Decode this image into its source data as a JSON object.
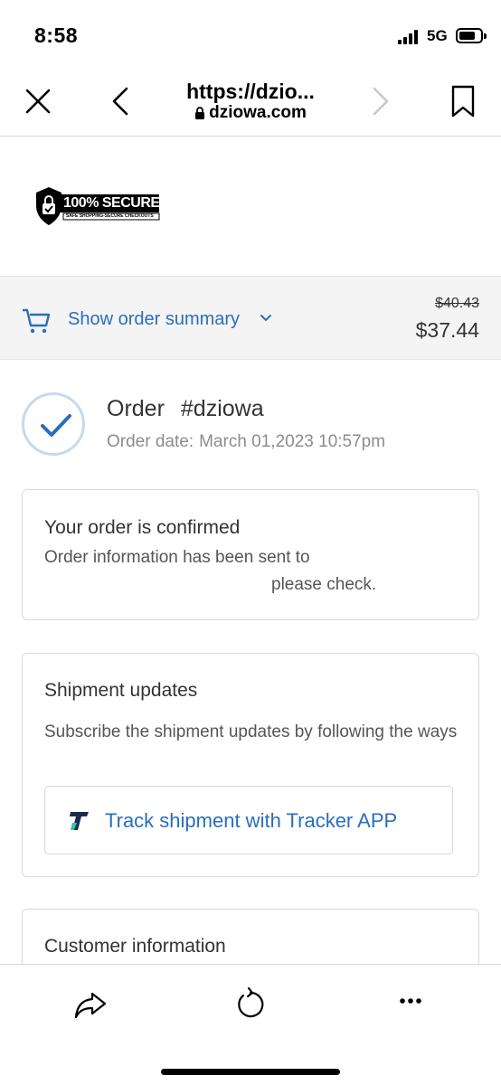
{
  "status_bar": {
    "time": "8:58",
    "network": "5G"
  },
  "browser": {
    "url_title": "https://dzio...",
    "domain": "dziowa.com",
    "icons": [
      "close-icon",
      "back-icon",
      "forward-icon",
      "bookmark-icon",
      "lock-icon"
    ]
  },
  "badge": {
    "title": "100% SECURE",
    "subtitle": "SAFE SHOPPING-SECURE CHECKOUTS"
  },
  "order_summary": {
    "label": "Show order summary",
    "original_price": "$40.43",
    "price": "$37.44",
    "accent_color": "#2a6ebb"
  },
  "order": {
    "label": "Order",
    "number": "#dziowa",
    "date_label": "Order date:",
    "date_value": "March 01,2023 10:57pm"
  },
  "confirm_card": {
    "title": "Your order is confirmed",
    "line1": "Order information has been sent to",
    "line2": "please check."
  },
  "shipment_card": {
    "title": "Shipment updates",
    "description": "Subscribe the shipment updates by following the ways",
    "track_button": "Track shipment with Tracker APP"
  },
  "customer_card": {
    "title": "Customer information"
  },
  "toolbar": {
    "icons": [
      "share-icon",
      "reload-icon",
      "more-icon"
    ]
  }
}
